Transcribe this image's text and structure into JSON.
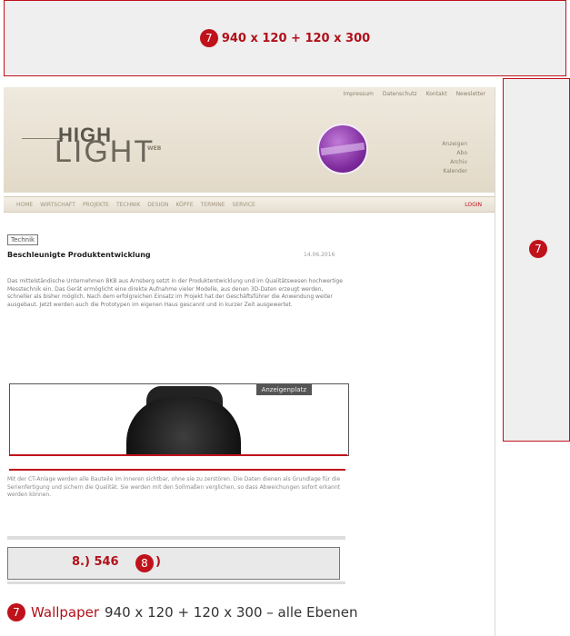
{
  "colors": {
    "accent": "#c0121b",
    "banner_bg": "#efefef",
    "header_bg": "#e6dfd1"
  },
  "top_banner": {
    "badge": "7",
    "label": "940 x 120 + 120 x 300"
  },
  "skyscraper": {
    "badge": "7"
  },
  "site": {
    "top_links": [
      "Impressum",
      "Datenschutz",
      "Kontakt",
      "Newsletter"
    ],
    "logo_high": "HIGH",
    "logo_light": "LIGHT",
    "logo_web": "WEB",
    "side_links": [
      "Anzeigen",
      "Abo",
      "Archiv",
      "Kalender"
    ],
    "nav": [
      "Home",
      "Wirtschaft",
      "Projekte",
      "Technik",
      "Design",
      "Köpfe",
      "Termine",
      "Service"
    ],
    "login": "Login",
    "tag": "Technik",
    "article_title": "Beschleunigte Produktentwicklung",
    "article_date": "14.06.2016",
    "article_body": "Das mittelständische Unternehmen BKB aus Arnsberg setzt in der Produktentwicklung und im Qualitätswesen hochwertige Messtechnik ein. Das Gerät ermöglicht eine direkte Aufnahme vieler Modelle, aus denen 3D-Daten erzeugt werden, schneller als bisher möglich. Nach dem erfolgreichen Einsatz im Projekt hat der Geschäftsführer die Anwendung weiter ausgebaut. Jetzt werden auch die Prototypen im eigenen Haus gescannt und in kurzer Zeit ausgewertet.",
    "hero_label": "Anzeigenplatz",
    "lower_body": "Mit der CT-Anlage werden alle Bauteile im Inneren sichtbar, ohne sie zu zerstören. Die Daten dienen als Grundlage für die Serienfertigung und sichern die Qualität. Sie werden mit den Sollmaßen verglichen, so dass Abweichungen sofort erkannt werden können."
  },
  "banner8": {
    "label": "8.) 546",
    "badge": "8",
    "tail": ")"
  },
  "caption": {
    "badge": "7",
    "accent": "Wallpaper",
    "rest": "940 x 120 + 120 x 300 – alle Ebenen"
  }
}
